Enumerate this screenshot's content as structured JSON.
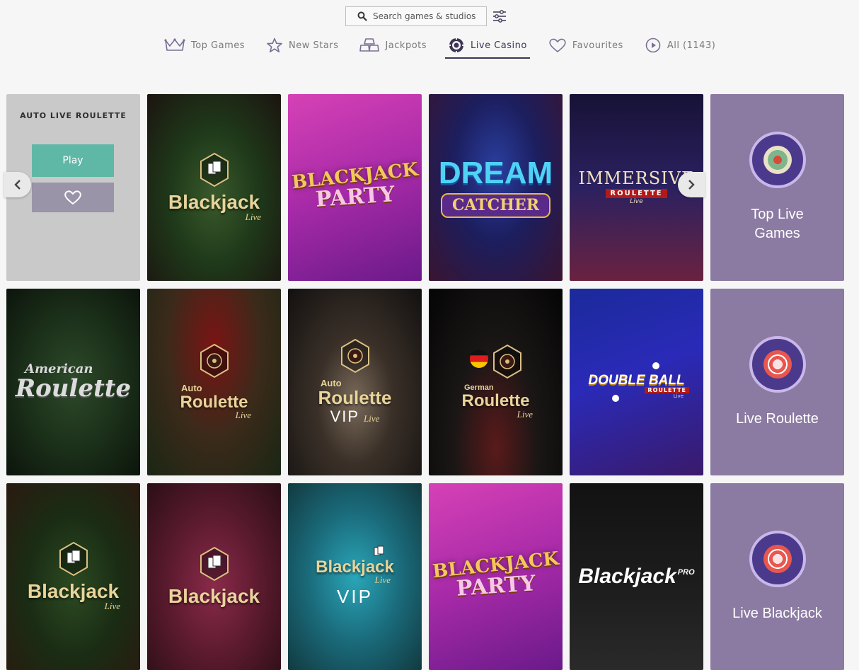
{
  "search": {
    "placeholder": "Search games & studios"
  },
  "tabs": [
    {
      "label": "Top Games",
      "icon": "crown-icon"
    },
    {
      "label": "New Stars",
      "icon": "star-icon"
    },
    {
      "label": "Jackpots",
      "icon": "gold-bars-icon"
    },
    {
      "label": "Live Casino",
      "icon": "live-chip-icon"
    },
    {
      "label": "Favourites",
      "icon": "heart-icon"
    },
    {
      "label": "All (1143)",
      "icon": "play-circle-icon"
    }
  ],
  "active_tab": "Live Casino",
  "hover_tile": {
    "title": "AUTO LIVE ROULETTE",
    "play_label": "Play"
  },
  "games": {
    "r1c2": {
      "main": "Blackjack",
      "sub": "Live"
    },
    "r1c3": {
      "main": "BLACKJACK",
      "sub": "PARTY"
    },
    "r1c4": {
      "main": "DREAM",
      "sub": "CATCHER"
    },
    "r1c5": {
      "main": "IMMERSIVE",
      "sub": "ROULETTE",
      "tag": "Live"
    },
    "r2c1": {
      "main": "American",
      "sub": "Roulette"
    },
    "r2c2": {
      "pre": "Auto",
      "main": "Roulette",
      "sub": "Live"
    },
    "r2c3": {
      "pre": "Auto",
      "main": "Roulette",
      "vip": "VIP",
      "sub": "Live"
    },
    "r2c4": {
      "pre": "German",
      "main": "Roulette",
      "sub": "Live"
    },
    "r2c5": {
      "main": "DOUBLE BALL",
      "sub": "ROULETTE",
      "tag": "Live"
    },
    "r3c1": {
      "main": "Blackjack",
      "sub": "Live"
    },
    "r3c2": {
      "main": "Blackjack"
    },
    "r3c3": {
      "main": "Blackjack",
      "sub": "Live",
      "vip": "VIP"
    },
    "r3c4": {
      "main": "BLACKJACK",
      "sub": "PARTY"
    },
    "r3c5": {
      "main": "Blackjack",
      "sub": "PRO"
    }
  },
  "categories": [
    {
      "label": "Top Live Games"
    },
    {
      "label": "Live Roulette"
    },
    {
      "label": "Live Blackjack"
    }
  ],
  "colors": {
    "category_bg": "#8b7aa2",
    "badge": "#4b3a8c",
    "accent_teal": "#5fb7a5",
    "active_tab": "#3d3556"
  }
}
